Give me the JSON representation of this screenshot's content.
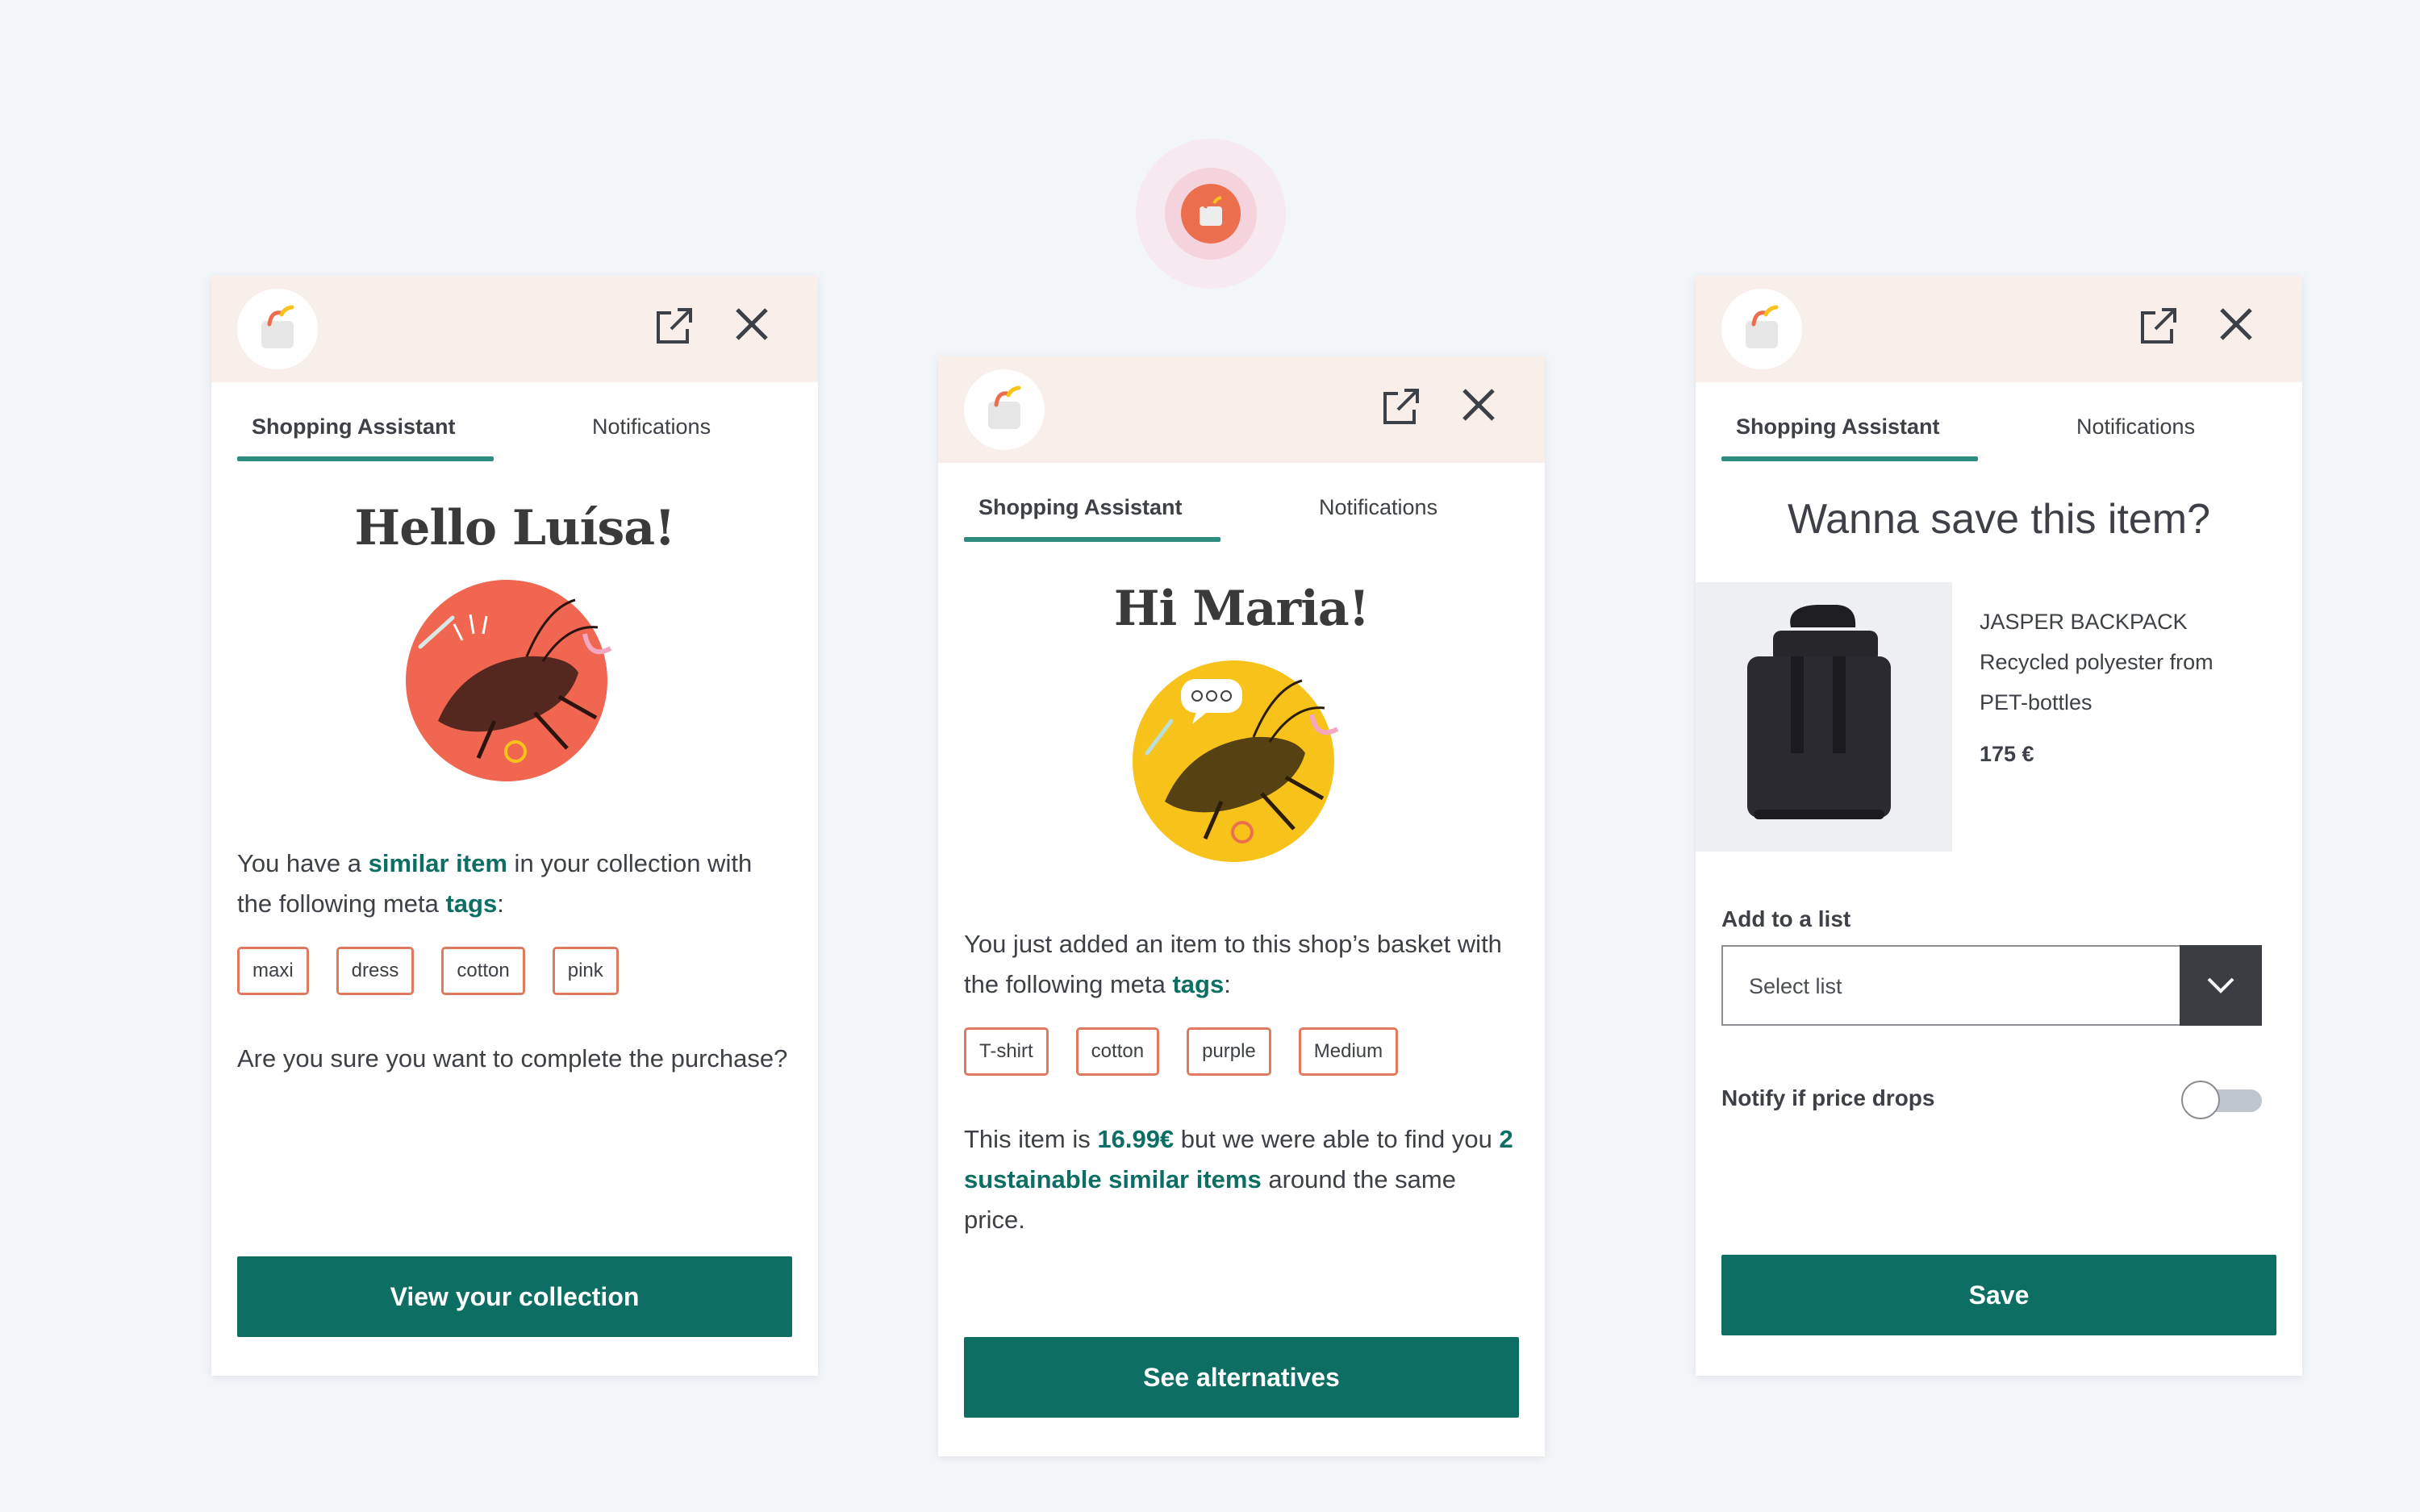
{
  "launcher": {
    "icon": "shopping-bag-logo-icon"
  },
  "cards": [
    {
      "header": {
        "open_icon": "external-link-icon",
        "close_icon": "close-icon"
      },
      "tabs": [
        "Shopping Assistant",
        "Notifications"
      ],
      "greeting": "Hello Luísa!",
      "text_before": "You have a ",
      "text_highlight": "similar item",
      "text_middle": " in your collection with the following meta ",
      "text_tags_word": "tags",
      "text_after": ":",
      "tags": [
        "maxi",
        "dress",
        "cotton",
        "pink"
      ],
      "question": "Are you sure you want to complete the purchase?",
      "button": "View your collection"
    },
    {
      "header": {
        "open_icon": "external-link-icon",
        "close_icon": "close-icon"
      },
      "tabs": [
        "Shopping Assistant",
        "Notifications"
      ],
      "greeting": "Hi Maria!",
      "text_before": "You just added an item to this shop’s basket with the following meta ",
      "text_tags_word": "tags",
      "text_after": ":",
      "tags": [
        "T-shirt",
        "cotton",
        "purple",
        "Medium"
      ],
      "price_before": "This item is ",
      "price_value": "16.99€",
      "price_middle": " but we were able to find you ",
      "price_highlight": "2 sustainable similar items",
      "price_after": " around the same price.",
      "button": "See alternatives"
    },
    {
      "header": {
        "open_icon": "external-link-icon",
        "close_icon": "close-icon"
      },
      "tabs": [
        "Shopping Assistant",
        "Notifications"
      ],
      "title": "Wanna save this item?",
      "product": {
        "name": "JASPER BACKPACK",
        "material_line1": "Recycled polyester from",
        "material_line2": "PET-bottles",
        "price": "175 €"
      },
      "list_label": "Add to a list",
      "select_placeholder": "Select list",
      "notify_label": "Notify if price drops",
      "notify_on": false,
      "button": "Save"
    }
  ],
  "colors": {
    "accent": "#0d6f63",
    "tag_border": "#e07a5f",
    "header_bg": "#f8efeb",
    "illustration_red": "#f06650",
    "illustration_yellow": "#f7c31b"
  }
}
